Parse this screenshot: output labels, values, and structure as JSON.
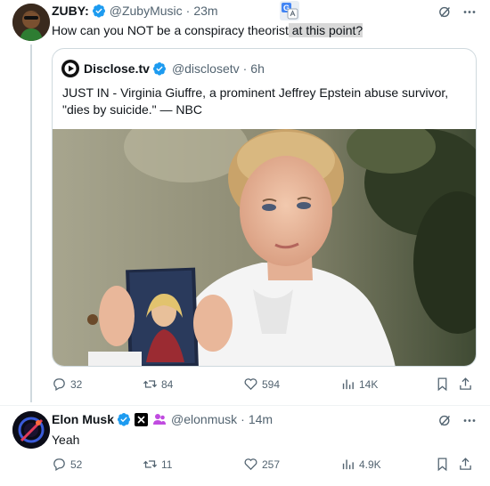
{
  "post1": {
    "name": "ZUBY:",
    "handle": "@ZubyMusic",
    "sep": "·",
    "time": "23m",
    "text_main": "How can you NOT be a conspiracy theorist",
    "text_highlight": " at this point?",
    "avatar_icon": "zuby-avatar",
    "verified_icon": "verified-badge-icon",
    "translate_icon": "translate-icon",
    "grok_icon": "grok-icon",
    "more_icon": "more-icon"
  },
  "quote": {
    "name": "Disclose.tv",
    "handle": "@disclosetv",
    "sep": "·",
    "time": "6h",
    "text": "JUST IN - Virginia Giuffre, a prominent Jeffrey Epstein abuse survivor, \"dies by suicide.\" — NBC",
    "logo_icon": "disclosetv-logo",
    "photo": "news-photo"
  },
  "post1_actions": {
    "replies": "32",
    "reposts": "84",
    "likes": "594",
    "views": "14K"
  },
  "post2": {
    "name": "Elon Musk",
    "handle": "@elonmusk",
    "sep": "·",
    "time": "14m",
    "text": "Yeah",
    "avatar_icon": "elonmusk-avatar",
    "x_badge_icon": "x-affiliate-icon",
    "affiliate_icon": "affiliate-people-icon"
  },
  "post2_actions": {
    "replies": "52",
    "reposts": "11",
    "likes": "257",
    "views": "4.9K"
  },
  "colors": {
    "verified": "#1d9bf0",
    "muted": "#536471",
    "border": "#cfd9de",
    "affiliate": "#c04be0"
  }
}
